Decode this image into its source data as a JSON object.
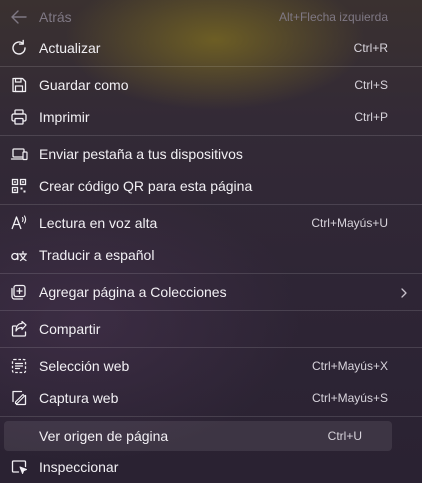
{
  "menu": {
    "back": {
      "label": "Atrás",
      "shortcut": "Alt+Flecha izquierda",
      "icon": "arrow-left-icon"
    },
    "refresh": {
      "label": "Actualizar",
      "shortcut": "Ctrl+R",
      "icon": "refresh-icon"
    },
    "save_as": {
      "label": "Guardar como",
      "shortcut": "Ctrl+S",
      "icon": "save-icon"
    },
    "print": {
      "label": "Imprimir",
      "shortcut": "Ctrl+P",
      "icon": "printer-icon"
    },
    "send_tab": {
      "label": "Enviar pestaña a tus dispositivos",
      "icon": "laptop-send-icon"
    },
    "qr_code": {
      "label": "Crear código QR para esta página",
      "icon": "qr-code-icon"
    },
    "read_aloud": {
      "label": "Lectura en voz alta",
      "shortcut": "Ctrl+Mayús+U",
      "icon": "read-aloud-icon"
    },
    "translate": {
      "label": "Traducir a español",
      "icon": "translate-icon"
    },
    "add_collection": {
      "label": "Agregar página a Colecciones",
      "icon": "collections-add-icon"
    },
    "share": {
      "label": "Compartir",
      "icon": "share-icon"
    },
    "web_select": {
      "label": "Selección web",
      "shortcut": "Ctrl+Mayús+X",
      "icon": "web-select-icon"
    },
    "web_capture": {
      "label": "Captura web",
      "shortcut": "Ctrl+Mayús+S",
      "icon": "web-capture-icon"
    },
    "view_source": {
      "label": "Ver origen de página",
      "shortcut": "Ctrl+U"
    },
    "inspect": {
      "label": "Inspeccionar",
      "icon": "inspect-icon"
    }
  },
  "colors": {
    "text": "#f2f0f4",
    "disabled": "#7f7884",
    "separator": "#ffffff21"
  }
}
